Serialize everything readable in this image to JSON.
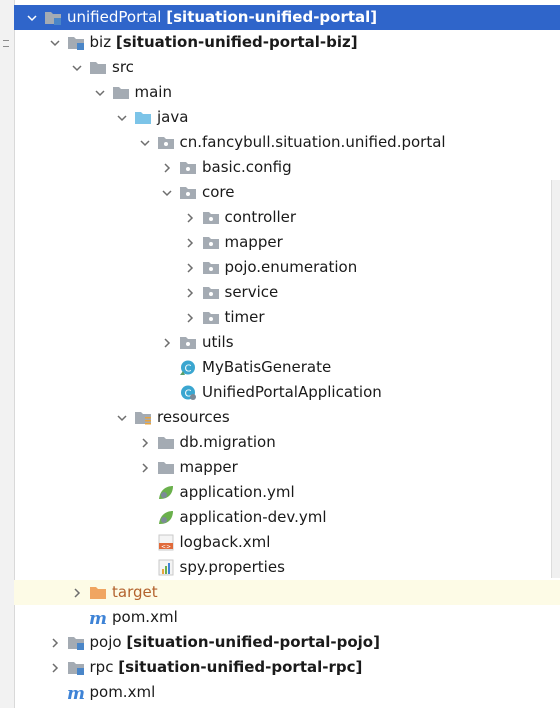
{
  "tree": [
    {
      "key": "unifiedPortal",
      "depth": 0,
      "arrow": "down",
      "icon": "module-folder",
      "name": "unifiedPortal",
      "suffix": "[situation-unified-portal]",
      "selected": true
    },
    {
      "key": "biz",
      "depth": 1,
      "arrow": "down",
      "icon": "module-folder",
      "name": "biz",
      "suffix": "[situation-unified-portal-biz]"
    },
    {
      "key": "src",
      "depth": 2,
      "arrow": "down",
      "icon": "folder",
      "name": "src"
    },
    {
      "key": "main",
      "depth": 3,
      "arrow": "down",
      "icon": "folder",
      "name": "main"
    },
    {
      "key": "java",
      "depth": 4,
      "arrow": "down",
      "icon": "source-folder",
      "name": "java"
    },
    {
      "key": "package",
      "depth": 5,
      "arrow": "down",
      "icon": "package",
      "name": "cn.fancybull.situation.unified.portal"
    },
    {
      "key": "basic-config",
      "depth": 6,
      "arrow": "right",
      "icon": "package",
      "name": "basic.config"
    },
    {
      "key": "core",
      "depth": 6,
      "arrow": "down",
      "icon": "package",
      "name": "core"
    },
    {
      "key": "controller",
      "depth": 7,
      "arrow": "right",
      "icon": "package",
      "name": "controller"
    },
    {
      "key": "mapper",
      "depth": 7,
      "arrow": "right",
      "icon": "package",
      "name": "mapper"
    },
    {
      "key": "pojo-enumeration",
      "depth": 7,
      "arrow": "right",
      "icon": "package",
      "name": "pojo.enumeration"
    },
    {
      "key": "service",
      "depth": 7,
      "arrow": "right",
      "icon": "package",
      "name": "service"
    },
    {
      "key": "timer",
      "depth": 7,
      "arrow": "right",
      "icon": "package",
      "name": "timer"
    },
    {
      "key": "utils",
      "depth": 6,
      "arrow": "right",
      "icon": "package",
      "name": "utils"
    },
    {
      "key": "mybatisgenerate",
      "depth": 6,
      "arrow": "none",
      "icon": "java-class",
      "name": "MyBatisGenerate"
    },
    {
      "key": "unifiedportalapplication",
      "depth": 6,
      "arrow": "none",
      "icon": "java-app-class",
      "name": "UnifiedPortalApplication"
    },
    {
      "key": "resources",
      "depth": 4,
      "arrow": "down",
      "icon": "resources-folder",
      "name": "resources"
    },
    {
      "key": "db-migration",
      "depth": 5,
      "arrow": "right",
      "icon": "folder",
      "name": "db.migration"
    },
    {
      "key": "resources-mapper",
      "depth": 5,
      "arrow": "right",
      "icon": "folder",
      "name": "mapper"
    },
    {
      "key": "application-yml",
      "depth": 5,
      "arrow": "none",
      "icon": "spring-config",
      "name": "application.yml"
    },
    {
      "key": "application-dev-yml",
      "depth": 5,
      "arrow": "none",
      "icon": "spring-config",
      "name": "application-dev.yml"
    },
    {
      "key": "logback-xml",
      "depth": 5,
      "arrow": "none",
      "icon": "xml-file",
      "name": "logback.xml"
    },
    {
      "key": "spy-properties",
      "depth": 5,
      "arrow": "none",
      "icon": "properties-file",
      "name": "spy.properties"
    },
    {
      "key": "target",
      "depth": 2,
      "arrow": "right",
      "icon": "excluded-folder",
      "name": "target",
      "highlight": true
    },
    {
      "key": "biz-pom",
      "depth": 2,
      "arrow": "none",
      "icon": "maven-file",
      "name": "pom.xml"
    },
    {
      "key": "pojo",
      "depth": 1,
      "arrow": "right",
      "icon": "module-folder",
      "name": "pojo",
      "suffix": "[situation-unified-portal-pojo]"
    },
    {
      "key": "rpc",
      "depth": 1,
      "arrow": "right",
      "icon": "module-folder",
      "name": "rpc",
      "suffix": "[situation-unified-portal-rpc]"
    },
    {
      "key": "root-pom",
      "depth": 1,
      "arrow": "none",
      "icon": "maven-file",
      "name": "pom.xml"
    }
  ],
  "colors": {
    "selection": "#2f65ca",
    "folder": "#a4abb3",
    "source_folder": "#7cc4e8",
    "excluded_folder": "#f0a561",
    "maven": "#3e83d6",
    "class": "#3aa6d0",
    "spring": "#6ab04c",
    "xml": "#e06a3a"
  }
}
